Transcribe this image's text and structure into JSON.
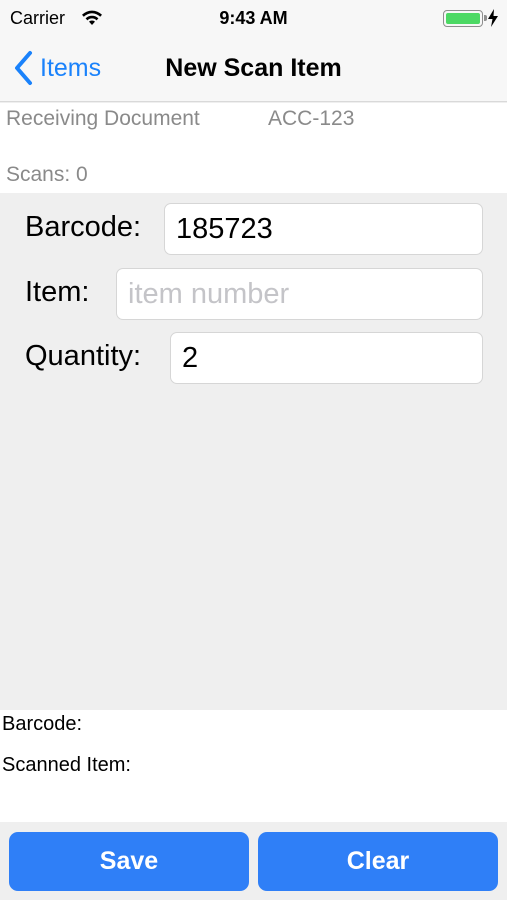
{
  "status_bar": {
    "carrier": "Carrier",
    "time": "9:43 AM",
    "battery_level": 1.0,
    "icons": [
      "wifi-icon",
      "battery-icon",
      "charging-icon"
    ]
  },
  "nav": {
    "back_label": "Items",
    "title": "New Scan Item",
    "back_icon": "chevron-left-icon"
  },
  "document": {
    "label": "Receiving Document",
    "value": "ACC-123",
    "scans": "Scans: 0"
  },
  "form": {
    "barcode_label": "Barcode:",
    "barcode_value": "185723",
    "item_label": "Item:",
    "item_value": "",
    "item_placeholder": "item number",
    "quantity_label": "Quantity:",
    "quantity_value": "2"
  },
  "scan_result": {
    "barcode_line": "Barcode:",
    "scanned_item_line": "Scanned Item:"
  },
  "actions": {
    "save_label": "Save",
    "clear_label": "Clear"
  },
  "colors": {
    "accent": "#1a82fb",
    "button": "#2f7ff7",
    "battery": "#4cd964",
    "background": "#efefef"
  }
}
